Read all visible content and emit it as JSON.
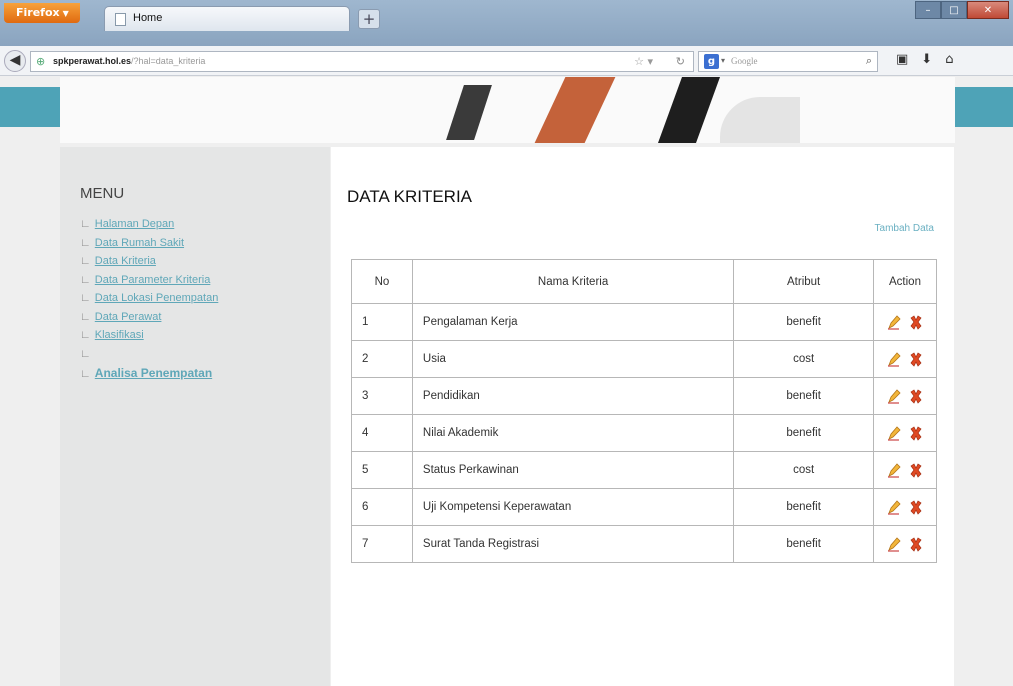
{
  "browser": {
    "app_button": "Firefox",
    "tab_title": "Home",
    "url_domain": "spkperawat.hol.es",
    "url_path": "/?hal=data_kriteria",
    "search_placeholder": "Google"
  },
  "sidebar": {
    "title": "MENU",
    "items": [
      {
        "label": "Halaman Depan"
      },
      {
        "label": "Data Rumah Sakit"
      },
      {
        "label": "Data Kriteria"
      },
      {
        "label": "Data Parameter Kriteria"
      },
      {
        "label": "Data Lokasi Penempatan"
      },
      {
        "label": "Data Perawat"
      },
      {
        "label": "Klasifikasi"
      },
      {
        "label": ""
      },
      {
        "label": "Analisa Penempatan"
      }
    ]
  },
  "content": {
    "title": "DATA KRITERIA",
    "add_link": "Tambah Data",
    "table": {
      "headers": [
        "No",
        "Nama Kriteria",
        "Atribut",
        "Action"
      ],
      "rows": [
        {
          "no": "1",
          "nama": "Pengalaman Kerja",
          "atribut": "benefit"
        },
        {
          "no": "2",
          "nama": "Usia",
          "atribut": "cost"
        },
        {
          "no": "3",
          "nama": "Pendidikan",
          "atribut": "benefit"
        },
        {
          "no": "4",
          "nama": "Nilai Akademik",
          "atribut": "benefit"
        },
        {
          "no": "5",
          "nama": "Status Perkawinan",
          "atribut": "cost"
        },
        {
          "no": "6",
          "nama": "Uji Kompetensi Keperawatan",
          "atribut": "benefit"
        },
        {
          "no": "7",
          "nama": "Surat Tanda Registrasi",
          "atribut": "benefit"
        }
      ]
    }
  },
  "colors": {
    "header_accent": "#4ea3b7",
    "link": "#5fa7b8",
    "edit_icon": "#e8a020",
    "delete_icon": "#d23a1e"
  }
}
